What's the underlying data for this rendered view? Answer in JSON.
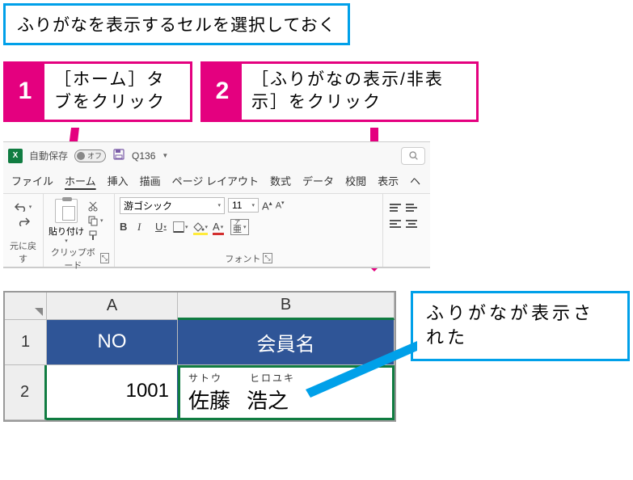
{
  "instruction": "ふりがなを表示するセルを選択しておく",
  "steps": [
    {
      "num": "1",
      "text": "［ホーム］タブをクリック"
    },
    {
      "num": "2",
      "text": "［ふりがなの表示/非表示］をクリック"
    }
  ],
  "titlebar": {
    "autosave_label": "自動保存",
    "autosave_state": "オフ",
    "doc_name": "Q136"
  },
  "tabs": {
    "file": "ファイル",
    "home": "ホーム",
    "insert": "挿入",
    "draw": "描画",
    "pagelayout": "ページ レイアウト",
    "formulas": "数式",
    "data": "データ",
    "review": "校閲",
    "view": "表示",
    "help": "ヘ"
  },
  "ribbon": {
    "undo_label": "元に戻す",
    "clipboard_label": "クリップボード",
    "paste_label": "貼り付け",
    "font_label": "フォント",
    "font_name": "游ゴシック",
    "font_size": "11",
    "bold": "B",
    "italic": "I",
    "underline": "U",
    "font_color_letter": "A",
    "phonetic_letter": "ア亜"
  },
  "sheet": {
    "col_a": "A",
    "col_b": "B",
    "row1": "1",
    "row2": "2",
    "header_no": "NO",
    "header_name": "会員名",
    "value_no": "1001",
    "furigana1": "サトウ",
    "furigana2": "ヒロユキ",
    "kanji1": "佐藤",
    "kanji2": "浩之"
  },
  "result": "ふりがなが表示された"
}
